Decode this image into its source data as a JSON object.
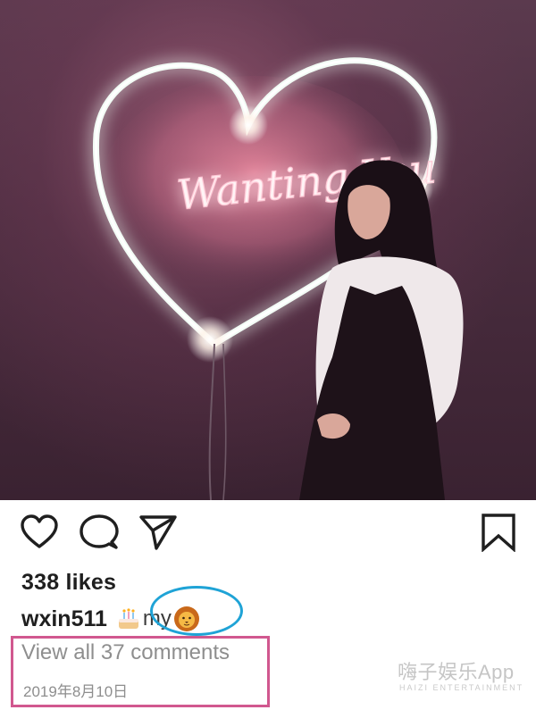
{
  "post": {
    "photo_icon": "neon-heart-photo",
    "neon_script": "Wanting You"
  },
  "actions": {
    "like_icon": "heart-outline-icon",
    "comment_icon": "speech-bubble-icon",
    "share_icon": "paper-plane-icon",
    "save_icon": "bookmark-icon"
  },
  "likes": "338 likes",
  "caption": {
    "username": "wxin511",
    "emoji_1": "birthday-cake-emoji",
    "text": "my",
    "emoji_2": "lion-emoji"
  },
  "comments_link": "View all 37 comments",
  "date": "2019年8月10日",
  "watermark": {
    "main": "嗨子娱乐App",
    "sub": "HAIZI ENTERTAINMENT"
  },
  "colors": {
    "circle_highlight": "#1fa3d6",
    "box_highlight": "#d1588f",
    "meta_gray": "#8e8e8e"
  }
}
